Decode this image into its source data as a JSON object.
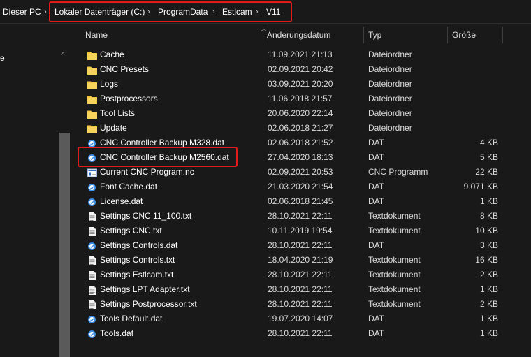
{
  "breadcrumb": {
    "root": "Dieser PC",
    "items": [
      "Lokaler Datenträger (C:)",
      "ProgramData",
      "Estlcam",
      "V11"
    ],
    "separator": "›"
  },
  "navpane": {
    "stub_label": "e",
    "chevron": "^"
  },
  "columns": {
    "name": "Name",
    "date": "Änderungsdatum",
    "type": "Typ",
    "size": "Größe"
  },
  "files": [
    {
      "name": "Cache",
      "date": "11.09.2021 21:13",
      "type": "Dateiordner",
      "size": "",
      "icon": "folder-icon"
    },
    {
      "name": "CNC Presets",
      "date": "02.09.2021 20:42",
      "type": "Dateiordner",
      "size": "",
      "icon": "folder-icon"
    },
    {
      "name": "Logs",
      "date": "03.09.2021 20:20",
      "type": "Dateiordner",
      "size": "",
      "icon": "folder-icon"
    },
    {
      "name": "Postprocessors",
      "date": "11.06.2018 21:57",
      "type": "Dateiordner",
      "size": "",
      "icon": "folder-icon"
    },
    {
      "name": "Tool Lists",
      "date": "20.06.2020 22:14",
      "type": "Dateiordner",
      "size": "",
      "icon": "folder-icon"
    },
    {
      "name": "Update",
      "date": "02.06.2018 21:27",
      "type": "Dateiordner",
      "size": "",
      "icon": "folder-icon"
    },
    {
      "name": "CNC Controller Backup M328.dat",
      "date": "02.06.2018 21:52",
      "type": "DAT",
      "size": "4 KB",
      "icon": "dat-file-icon"
    },
    {
      "name": "CNC Controller Backup M2560.dat",
      "date": "27.04.2020 18:13",
      "type": "DAT",
      "size": "5 KB",
      "icon": "dat-file-icon"
    },
    {
      "name": "Current CNC Program.nc",
      "date": "02.09.2021 20:53",
      "type": "CNC Programm",
      "size": "22 KB",
      "icon": "nc-file-icon"
    },
    {
      "name": "Font Cache.dat",
      "date": "21.03.2020 21:54",
      "type": "DAT",
      "size": "9.071 KB",
      "icon": "dat-file-icon"
    },
    {
      "name": "License.dat",
      "date": "02.06.2018 21:45",
      "type": "DAT",
      "size": "1 KB",
      "icon": "dat-file-icon"
    },
    {
      "name": "Settings CNC 11_100.txt",
      "date": "28.10.2021 22:11",
      "type": "Textdokument",
      "size": "8 KB",
      "icon": "text-file-icon"
    },
    {
      "name": "Settings CNC.txt",
      "date": "10.11.2019 19:54",
      "type": "Textdokument",
      "size": "10 KB",
      "icon": "text-file-icon"
    },
    {
      "name": "Settings Controls.dat",
      "date": "28.10.2021 22:11",
      "type": "DAT",
      "size": "3 KB",
      "icon": "dat-file-icon"
    },
    {
      "name": "Settings Controls.txt",
      "date": "18.04.2020 21:19",
      "type": "Textdokument",
      "size": "16 KB",
      "icon": "text-file-icon"
    },
    {
      "name": "Settings Estlcam.txt",
      "date": "28.10.2021 22:11",
      "type": "Textdokument",
      "size": "2 KB",
      "icon": "text-file-icon"
    },
    {
      "name": "Settings LPT Adapter.txt",
      "date": "28.10.2021 22:11",
      "type": "Textdokument",
      "size": "1 KB",
      "icon": "text-file-icon"
    },
    {
      "name": "Settings Postprocessor.txt",
      "date": "28.10.2021 22:11",
      "type": "Textdokument",
      "size": "2 KB",
      "icon": "text-file-icon"
    },
    {
      "name": "Tools Default.dat",
      "date": "19.07.2020 14:07",
      "type": "DAT",
      "size": "1 KB",
      "icon": "dat-file-icon"
    },
    {
      "name": "Tools.dat",
      "date": "28.10.2021 22:11",
      "type": "DAT",
      "size": "1 KB",
      "icon": "dat-file-icon"
    }
  ],
  "colors": {
    "background": "#191919",
    "highlight_border": "#e01b1b",
    "folder": "#f4c542",
    "dat_icon": "#3a8ee6"
  }
}
